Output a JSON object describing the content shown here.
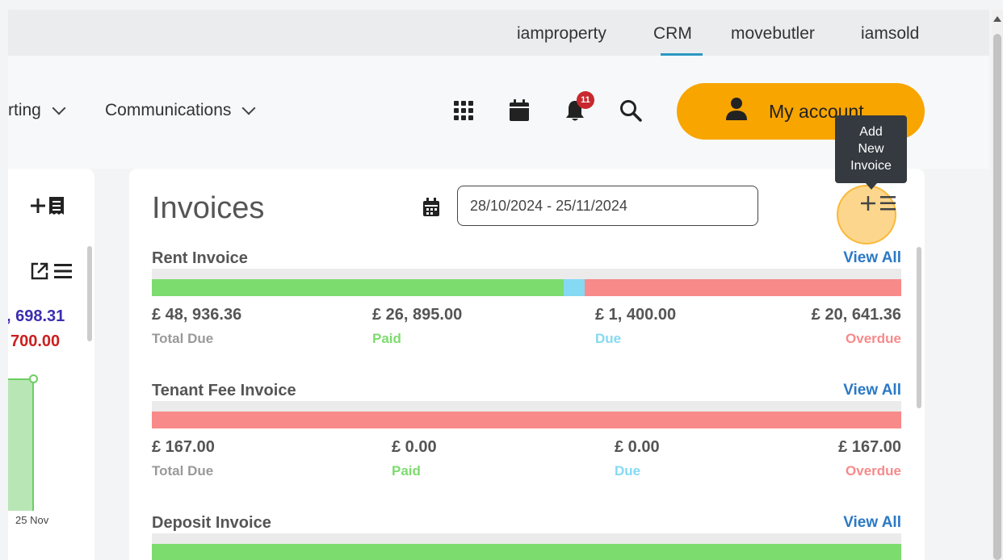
{
  "topbar": {
    "links": [
      {
        "label": "iamproperty"
      },
      {
        "label": "CRM"
      },
      {
        "label": "movebutler"
      },
      {
        "label": "iamsold"
      }
    ]
  },
  "nav": {
    "reporting_label": "rting",
    "communications_label": "Communications",
    "notification_count": "11",
    "icons": [
      "apps-grid-icon",
      "calendar-icon",
      "bell-icon",
      "search-icon"
    ]
  },
  "account": {
    "label": "My account"
  },
  "tooltip": {
    "lines": [
      "Add",
      "New",
      "Invoice"
    ]
  },
  "left_panel": {
    "value_1": ", 698.31",
    "value_2": "700.00",
    "date_label": "25 Nov",
    "colors": {
      "value_1": "#3c2eb0",
      "value_2": "#cc1f1f"
    }
  },
  "invoices": {
    "title": "Invoices",
    "date_range": "28/10/2024 - 25/11/2024",
    "view_all_label": "View All",
    "sections": [
      {
        "title": "Rent Invoice",
        "paid_frac": 0.55,
        "due_frac": 0.028,
        "overdue_frac": 0.422,
        "stats": [
          {
            "amount": "£ 48, 936.36",
            "label": "Total Due"
          },
          {
            "amount": "£ 26, 895.00",
            "label": "Paid"
          },
          {
            "amount": "£ 1, 400.00",
            "label": "Due"
          },
          {
            "amount": "£ 20, 641.36",
            "label": "Overdue"
          }
        ]
      },
      {
        "title": "Tenant Fee Invoice",
        "paid_frac": 0,
        "due_frac": 0,
        "overdue_frac": 1,
        "stats": [
          {
            "amount": "£ 167.00",
            "label": "Total Due"
          },
          {
            "amount": "£ 0.00",
            "label": "Paid"
          },
          {
            "amount": "£ 0.00",
            "label": "Due"
          },
          {
            "amount": "£ 167.00",
            "label": "Overdue"
          }
        ]
      },
      {
        "title": "Deposit Invoice"
      }
    ]
  },
  "colors": {
    "accent": "#f8a500",
    "link": "#2b79c4",
    "paid": "#7ddc6e",
    "due": "#85d9f3",
    "overdue": "#f88a8a"
  }
}
